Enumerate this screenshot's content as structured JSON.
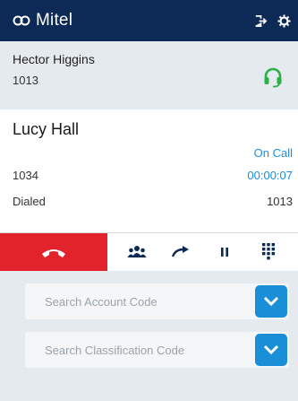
{
  "header": {
    "brand": "Mitel",
    "icons": [
      "logout-icon",
      "gear-icon"
    ]
  },
  "user": {
    "name": "Hector Higgins",
    "extension": "1013",
    "presence_icon": "headset-icon",
    "presence_color": "#2bb14a"
  },
  "call": {
    "caller_name": "Lucy Hall",
    "status": "On Call",
    "number": "1034",
    "timer": "00:00:07",
    "direction_label": "Dialed",
    "dialed_number": "1013"
  },
  "toolbar": {
    "hangup_color": "#e3232b",
    "icons": [
      "hangup-icon",
      "conference-icon",
      "transfer-icon",
      "hold-icon",
      "dialpad-icon"
    ]
  },
  "codes": {
    "account_placeholder": "Search Account Code",
    "classification_placeholder": "Search Classification Code"
  },
  "colors": {
    "header_bg": "#0d2a57",
    "accent": "#1a8fd8",
    "panel_bg": "#e5eaee"
  }
}
